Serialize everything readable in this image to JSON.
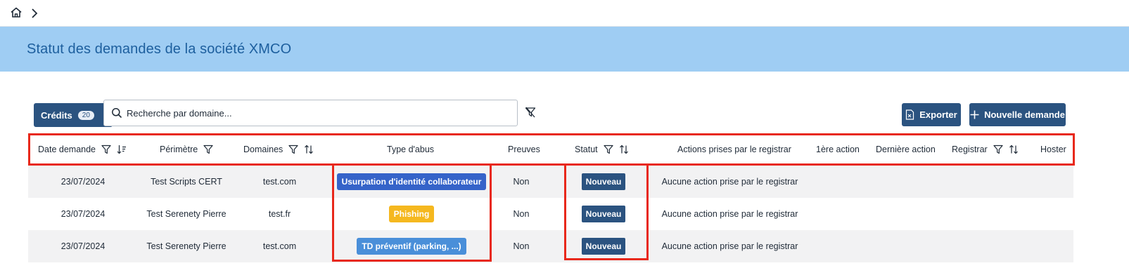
{
  "nav": {
    "home_icon": "home-icon",
    "separator_icon": "chevron-right-icon"
  },
  "banner": {
    "title": "Statut des demandes de la société XMCO"
  },
  "toolbar": {
    "credits_label": "Crédits",
    "credits_count": "20",
    "search_placeholder": "Recherche par domaine...",
    "export_label": "Exporter",
    "new_request_label": "Nouvelle demande"
  },
  "table": {
    "headers": {
      "date": "Date demande",
      "perimeter": "Périmètre",
      "domains": "Domaines",
      "abuse_type": "Type d'abus",
      "proofs": "Preuves",
      "status": "Statut",
      "actions": "Actions prises par le registrar",
      "first_action": "1ère action",
      "last_action": "Dernière action",
      "registrar": "Registrar",
      "hoster": "Hoster"
    },
    "rows": [
      {
        "date": "23/07/2024",
        "perimeter": "Test Scripts CERT",
        "domain": "test.com",
        "abuse_type": "Usurpation d'identité collaborateur",
        "proofs": "Non",
        "status": "Nouveau",
        "actions": "Aucune action prise par le registrar",
        "first_action": "",
        "last_action": "",
        "registrar": "",
        "hoster": ""
      },
      {
        "date": "23/07/2024",
        "perimeter": "Test Serenety Pierre",
        "domain": "test.fr",
        "abuse_type": "Phishing",
        "proofs": "Non",
        "status": "Nouveau",
        "actions": "Aucune action prise par le registrar",
        "first_action": "",
        "last_action": "",
        "registrar": "",
        "hoster": ""
      },
      {
        "date": "23/07/2024",
        "perimeter": "Test Serenety Pierre",
        "domain": "test.com",
        "abuse_type": "TD préventif (parking, ...)",
        "proofs": "Non",
        "status": "Nouveau",
        "actions": "Aucune action prise par le registrar",
        "first_action": "",
        "last_action": "",
        "registrar": "",
        "hoster": ""
      }
    ]
  },
  "colors": {
    "banner": "#9fcdf3",
    "primary": "#2b5380",
    "abuse_usurpation": "#3563c9",
    "abuse_phishing": "#f5b81f",
    "abuse_td": "#4a8fd9",
    "highlight": "#e8281b"
  }
}
